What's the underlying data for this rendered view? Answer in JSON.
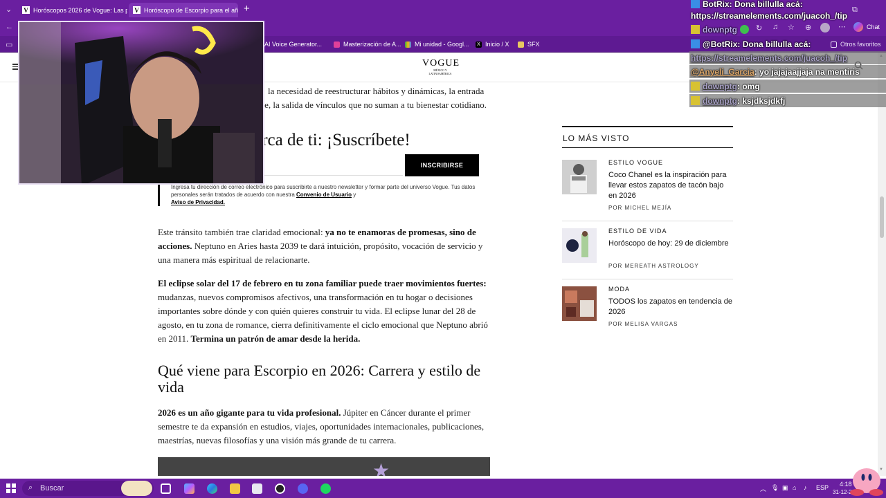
{
  "browser": {
    "tabs": [
      {
        "label": "Horóscopos 2026 de Vogue: Las p",
        "active": false
      },
      {
        "label": "Horóscopo de Escorpio para el añ",
        "active": true
      }
    ],
    "bookmarks": [
      "AI Voice Generator...",
      "Masterización de A...",
      "Mi unidad - Googl...",
      "Inicio / X",
      "SFX"
    ],
    "other_favorites": "Otros favoritos",
    "chat_button": "Chat"
  },
  "site": {
    "logo_word": "VOGUE",
    "logo_sub": "MÉXICO Y LATINOAMÉRICA",
    "intro_line1": "la necesidad de reestructurar hábitos y dinámicas, la entrada",
    "intro_line2_tail": "nte, la salida de vínculos que no suman a tu bienestar cotidiano.",
    "subscribe_heading": "cerca de ti: ¡Suscríbete!",
    "subscribe_button": "INSCRIBIRSE",
    "legal_text": "Ingresa tu dirección de correo electrónico para suscribirte a nuestro newsletter y formar parte del universo Vogue. Tus datos personales serán tratados de acuerdo con nuestra ",
    "legal_link1": "Convenio de Usuario",
    "legal_y": " y",
    "legal_link2": "Aviso de Privacidad.",
    "p1_a": "Este tránsito también trae claridad emocional: ",
    "p1_b": "ya no te enamoras de promesas, sino de acciones.",
    "p1_c": " Neptuno en Aries hasta 2039 te dará intuición, propósito, vocación de servicio y una manera más espiritual de relacionarte.",
    "p2_a": "El eclipse solar del 17 de febrero en tu zona familiar puede traer movimientos fuertes:",
    "p2_b": " mudanzas, nuevos compromisos afectivos, una transformación en tu hogar o decisiones importantes sobre dónde y con quién quieres construir tu vida. El eclipse lunar del 28 de agosto, en tu zona de romance, cierra definitivamente el ciclo emocional que Neptuno abrió en 2011. ",
    "p2_c": "Termina un patrón de amar desde la herida.",
    "h2": "Qué viene para Escorpio en 2026: Carrera y estilo de vida",
    "p3_a": "2026 es un año gigante para tu vida profesional.",
    "p3_b": " Júpiter en Cáncer durante el primer semestre te da expansión en estudios, viajes, oportunidades internacionales, publicaciones, maestrías, nuevas filosofías y una visión más grande de tu carrera."
  },
  "sidebar": {
    "title": "LO MÁS VISTO",
    "items": [
      {
        "category": "ESTILO VOGUE",
        "title": "Coco Chanel es la inspiración para llevar estos zapatos de tacón bajo en 2026",
        "byline": "POR MICHEL MEJÍA"
      },
      {
        "category": "ESTILO DE VIDA",
        "title": "Horóscopo de hoy: 29 de diciembre",
        "byline": "POR MEREATH ASTROLOGY"
      },
      {
        "category": "MODA",
        "title": "TODOS los zapatos en tendencia de 2026",
        "byline": "POR MELISA VARGAS"
      }
    ]
  },
  "chat": {
    "m1_user": "BotRix",
    "m1_text": ": Dona billulla acá:",
    "m1_link": "https://streamelements.com/juacoh_/tip",
    "m2_user": "downptg",
    "m3_link": "https://streamelements.com/juacoh_/tip",
    "m4_user": "@BotRix",
    "m4_text": ": Dona billulla acá:",
    "m5_user": "@Anyeli_Garcia",
    "m5_text": ": yo jajajaajjaja na mentiris",
    "m6_user": "downptg",
    "m6_text": ": omg",
    "m7_user": "downptg",
    "m7_text": ": ksjdksjdkfj"
  },
  "taskbar": {
    "search_placeholder": "Buscar",
    "lang": "ESP",
    "time": "4:18",
    "date": "31-12-2"
  },
  "colors": {
    "accent": "#6a1fa0",
    "page_bg": "#ffffff"
  }
}
